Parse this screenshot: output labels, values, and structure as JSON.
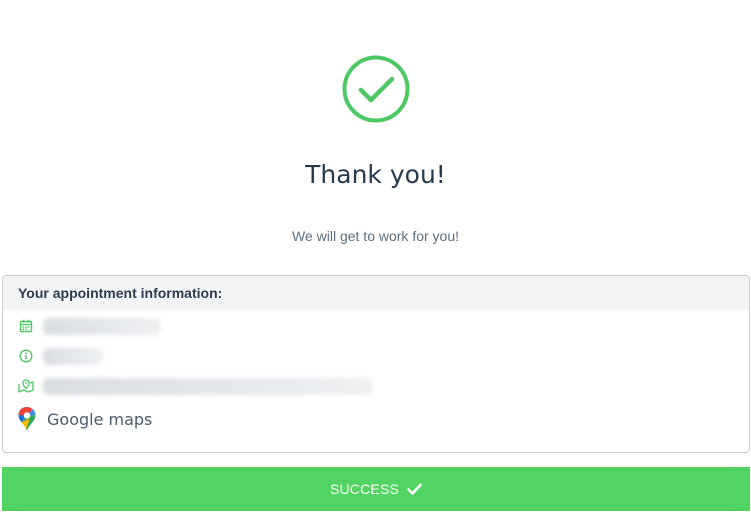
{
  "hero": {
    "title": "Thank you!",
    "subtitle": "We will get to work for you!",
    "icon": "check-circle-icon"
  },
  "appointment": {
    "header": "Your appointment information:",
    "rows": [
      {
        "icon": "calendar-icon",
        "value": ""
      },
      {
        "icon": "info-icon",
        "value": ""
      },
      {
        "icon": "map-icon",
        "value": ""
      },
      {
        "icon": "google-maps-pin-icon",
        "value": "Google maps"
      }
    ]
  },
  "status": {
    "label": "SUCCESS",
    "icon": "checkmark-icon"
  },
  "colors": {
    "accent": "#4ec865",
    "success_bar": "#52d462",
    "title_text": "#273a4e",
    "subtitle_text": "#5c6f80"
  }
}
